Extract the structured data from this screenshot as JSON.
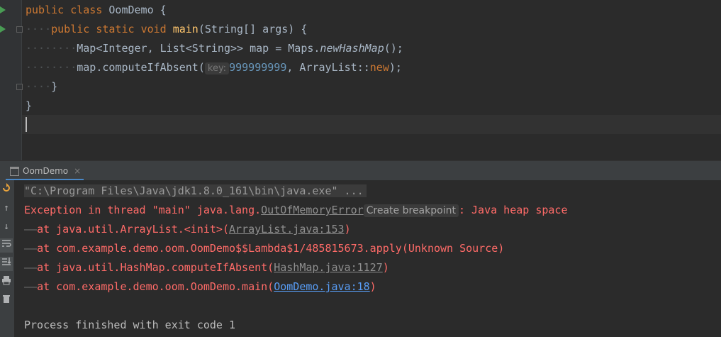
{
  "editor": {
    "lines": {
      "l1": {
        "kw1": "public",
        "kw2": "class",
        "name": "OomDemo",
        "brace": "{"
      },
      "l2": {
        "dots": "····",
        "kw1": "public",
        "kw2": "static",
        "kw3": "void",
        "fn": "main",
        "params": "(String[] args) {"
      },
      "l3": {
        "dots": "········",
        "pre": "Map<Integer, List<String>> map = Maps.",
        "method": "newHashMap",
        "post": "();"
      },
      "l4": {
        "dots": "········",
        "pre": "map.computeIfAbsent(",
        "hint": "key:",
        "num": "999999999",
        "mid": ", ArrayList::",
        "kw": "new",
        "post": ");"
      },
      "l5": {
        "dots": "····",
        "text": "}"
      },
      "l6": {
        "text": "}"
      }
    }
  },
  "tool_window": {
    "tab_label": "OomDemo",
    "tab_close": "×"
  },
  "console": {
    "cmd": "\"C:\\Program Files\\Java\\jdk1.8.0_161\\bin\\java.exe\" ...",
    "exception": {
      "prefix": "Exception in thread \"main\" java.lang.",
      "link": "OutOfMemoryError",
      "hint": "Create breakpoint",
      "suffix": ": Java heap space"
    },
    "stack": [
      {
        "dash": "——",
        "text": "at java.util.ArrayList.<init>(",
        "link": "ArrayList.java:153",
        "close": ")",
        "link_style": "gray"
      },
      {
        "dash": "——",
        "text": "at com.example.demo.oom.OomDemo$$Lambda$1/485815673.apply(Unknown Source)",
        "link": "",
        "close": "",
        "link_style": "none"
      },
      {
        "dash": "——",
        "text": "at java.util.HashMap.computeIfAbsent(",
        "link": "HashMap.java:1127",
        "close": ")",
        "link_style": "gray"
      },
      {
        "dash": "——",
        "text": "at com.example.demo.oom.OomDemo.main(",
        "link": "OomDemo.java:18",
        "close": ")",
        "link_style": "blue"
      }
    ],
    "exit": "Process finished with exit code 1"
  },
  "colors": {
    "keyword": "#cc7832",
    "method": "#ffc66d",
    "number": "#6897bb",
    "error": "#ff6b68",
    "link_blue": "#589df6"
  },
  "icons": [
    "run-icon",
    "fold-icon",
    "rerun-icon",
    "up-arrow-icon",
    "down-arrow-icon",
    "soft-wrap-icon",
    "scroll-to-end-icon",
    "print-icon",
    "trash-icon",
    "console-tab-icon",
    "close-icon"
  ]
}
